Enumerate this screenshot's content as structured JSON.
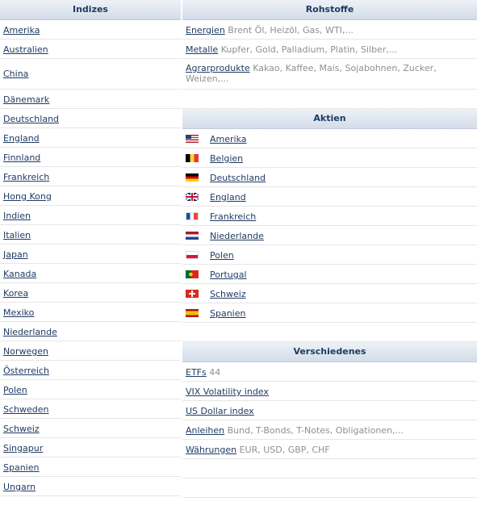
{
  "indizes": {
    "title": "Indizes",
    "items": [
      "Amerika",
      "Australien",
      "China",
      "Dänemark",
      "Deutschland",
      "England",
      "Finnland",
      "Frankreich",
      "Hong Kong",
      "Indien",
      "Italien",
      "Japan",
      "Kanada",
      "Korea",
      "Mexiko",
      "Niederlande",
      "Norwegen",
      "Österreich",
      "Polen",
      "Schweden",
      "Schweiz",
      "Singapur",
      "Spanien",
      "Ungarn"
    ]
  },
  "rohstoffe": {
    "title": "Rohstoffe",
    "items": [
      {
        "label": "Energien",
        "detail": "Brent Öl, Heizöl, Gas, WTI,..."
      },
      {
        "label": "Metalle",
        "detail": "Kupfer, Gold, Palladium, Platin, Silber,..."
      },
      {
        "label": "Agrarprodukte",
        "detail": "Kakao, Kaffee, Mais, Sojabohnen, Zucker, Weizen,..."
      }
    ]
  },
  "aktien": {
    "title": "Aktien",
    "items": [
      {
        "label": "Amerika",
        "flag": "flag-us-icon"
      },
      {
        "label": "Belgien",
        "flag": "flag-be-icon"
      },
      {
        "label": "Deutschland",
        "flag": "flag-de-icon"
      },
      {
        "label": "England",
        "flag": "flag-gb-icon"
      },
      {
        "label": "Frankreich",
        "flag": "flag-fr-icon"
      },
      {
        "label": "Niederlande",
        "flag": "flag-nl-icon"
      },
      {
        "label": "Polen",
        "flag": "flag-pl-icon"
      },
      {
        "label": "Portugal",
        "flag": "flag-pt-icon"
      },
      {
        "label": "Schweiz",
        "flag": "flag-ch-icon"
      },
      {
        "label": "Spanien",
        "flag": "flag-es-icon"
      }
    ]
  },
  "verschiedenes": {
    "title": "Verschiedenes",
    "items": [
      {
        "label": "ETFs",
        "detail": "44"
      },
      {
        "label": "VIX Volatility index",
        "detail": ""
      },
      {
        "label": "US Dollar index",
        "detail": ""
      },
      {
        "label": "Anleihen",
        "detail": "Bund, T-Bonds, T-Notes, Obligationen,..."
      },
      {
        "label": "Währungen",
        "detail": "EUR, USD, GBP, CHF"
      }
    ]
  },
  "colors": {
    "link": "#1f3b63",
    "muted": "#8f8f8f",
    "header_bg": "#d3dce8"
  }
}
